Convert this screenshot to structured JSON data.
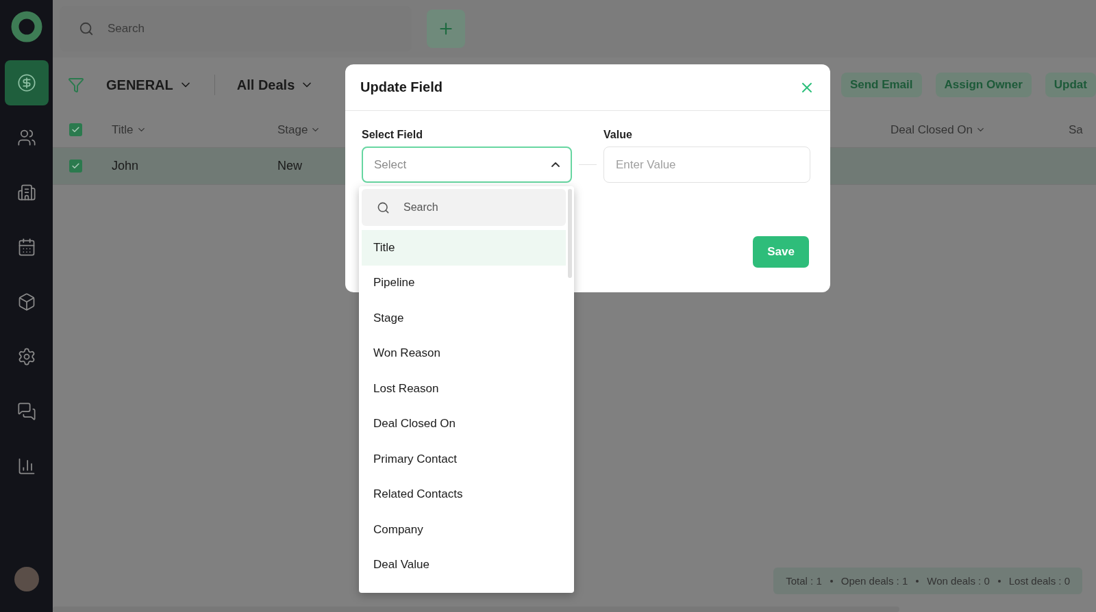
{
  "sidebar": {
    "items": [
      {
        "kind": "deals",
        "selected": true
      },
      {
        "kind": "contacts",
        "selected": false
      },
      {
        "kind": "companies",
        "selected": false
      },
      {
        "kind": "calendar",
        "selected": false
      },
      {
        "kind": "products",
        "selected": false
      },
      {
        "kind": "settings",
        "selected": false
      },
      {
        "kind": "chat",
        "selected": false
      },
      {
        "kind": "reports",
        "selected": false
      }
    ]
  },
  "topbar": {
    "search": {
      "placeholder": "Search"
    }
  },
  "toolbar": {
    "pipeline": "GENERAL",
    "view": "All Deals",
    "actions": [
      "Send Email",
      "Assign Owner",
      "Updat"
    ]
  },
  "table": {
    "all_checked": true,
    "columns": [
      "Title",
      "Stage",
      "Deal Closed On",
      "Sa"
    ],
    "rows": [
      {
        "checked": true,
        "cells": [
          "John",
          "New"
        ]
      }
    ]
  },
  "status_bar": [
    "Total : 1",
    "Open deals : 1",
    "Won deals : 0",
    "Lost deals : 0"
  ],
  "modal": {
    "title": "Update Field",
    "field_label": "Select Field",
    "value_label": "Value",
    "select": {
      "placeholder": "Select",
      "expanded": true
    },
    "value": {
      "placeholder": "Enter Value"
    },
    "save": "Save",
    "dropdown": {
      "search": {
        "placeholder": "Search"
      },
      "options": [
        {
          "label": "Title",
          "selected": true
        },
        {
          "label": "Pipeline",
          "selected": false
        },
        {
          "label": "Stage",
          "selected": false
        },
        {
          "label": "Won Reason",
          "selected": false
        },
        {
          "label": "Lost Reason",
          "selected": false
        },
        {
          "label": "Deal Closed On",
          "selected": false
        },
        {
          "label": "Primary Contact",
          "selected": false
        },
        {
          "label": "Related Contacts",
          "selected": false
        },
        {
          "label": "Company",
          "selected": false
        },
        {
          "label": "Deal Value",
          "selected": false
        }
      ]
    }
  }
}
